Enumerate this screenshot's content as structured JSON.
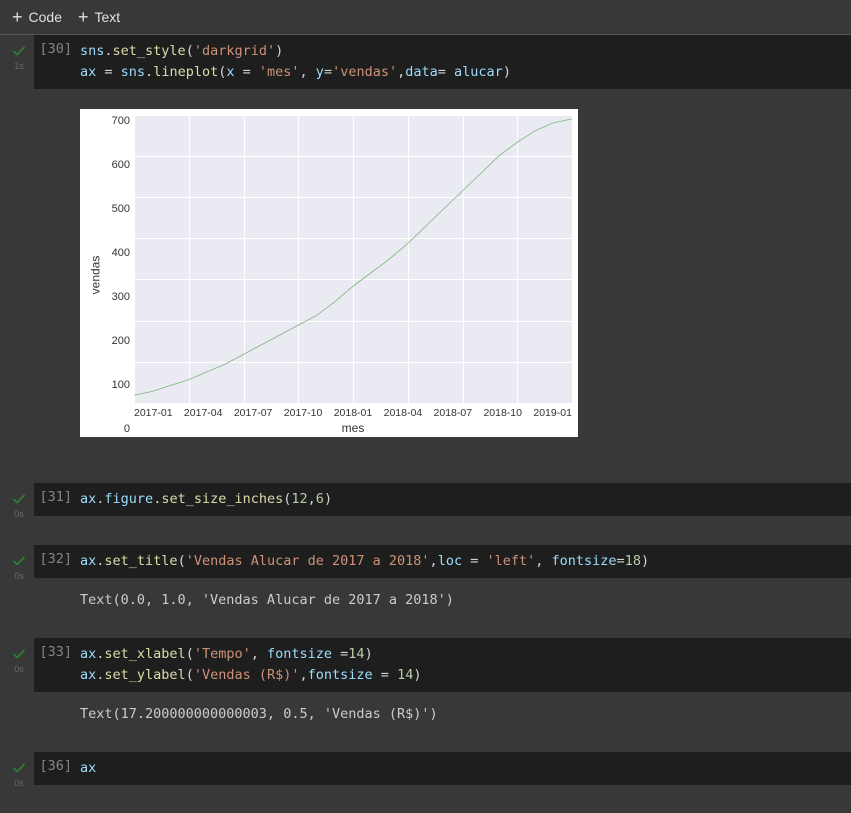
{
  "toolbar": {
    "code": "Code",
    "text": "Text"
  },
  "cells": [
    {
      "exec_count": "[30]",
      "exec_time": "1s",
      "code_tokens": [
        [
          "var",
          "sns"
        ],
        [
          "plain",
          "."
        ],
        [
          "fn",
          "set_style"
        ],
        [
          "plain",
          "("
        ],
        [
          "str",
          "'darkgrid'"
        ],
        [
          "plain",
          ")\n"
        ],
        [
          "var",
          "ax"
        ],
        [
          "plain",
          " = "
        ],
        [
          "var",
          "sns"
        ],
        [
          "plain",
          "."
        ],
        [
          "fn",
          "lineplot"
        ],
        [
          "plain",
          "("
        ],
        [
          "var",
          "x"
        ],
        [
          "plain",
          " = "
        ],
        [
          "str",
          "'mes'"
        ],
        [
          "plain",
          ", "
        ],
        [
          "var",
          "y"
        ],
        [
          "plain",
          "="
        ],
        [
          "str",
          "'vendas'"
        ],
        [
          "plain",
          ","
        ],
        [
          "var",
          "data"
        ],
        [
          "plain",
          "= "
        ],
        [
          "var",
          "alucar"
        ],
        [
          "plain",
          ")"
        ]
      ]
    },
    {
      "exec_count": "[31]",
      "exec_time": "0s",
      "code_tokens": [
        [
          "var",
          "ax"
        ],
        [
          "plain",
          "."
        ],
        [
          "var",
          "figure"
        ],
        [
          "plain",
          "."
        ],
        [
          "fn",
          "set_size_inches"
        ],
        [
          "plain",
          "("
        ],
        [
          "num",
          "12"
        ],
        [
          "plain",
          ","
        ],
        [
          "num",
          "6"
        ],
        [
          "plain",
          ")"
        ]
      ]
    },
    {
      "exec_count": "[32]",
      "exec_time": "0s",
      "code_tokens": [
        [
          "var",
          "ax"
        ],
        [
          "plain",
          "."
        ],
        [
          "fn",
          "set_title"
        ],
        [
          "plain",
          "("
        ],
        [
          "str",
          "'Vendas Alucar de 2017 a 2018'"
        ],
        [
          "plain",
          ","
        ],
        [
          "var",
          "loc"
        ],
        [
          "plain",
          " = "
        ],
        [
          "str",
          "'left'"
        ],
        [
          "plain",
          ", "
        ],
        [
          "var",
          "fontsize"
        ],
        [
          "plain",
          "="
        ],
        [
          "num",
          "18"
        ],
        [
          "plain",
          ")"
        ]
      ],
      "output": "Text(0.0, 1.0, 'Vendas Alucar de 2017 a 2018')"
    },
    {
      "exec_count": "[33]",
      "exec_time": "0s",
      "code_tokens": [
        [
          "var",
          "ax"
        ],
        [
          "plain",
          "."
        ],
        [
          "fn",
          "set_xlabel"
        ],
        [
          "plain",
          "("
        ],
        [
          "str",
          "'Tempo'"
        ],
        [
          "plain",
          ", "
        ],
        [
          "var",
          "fontsize"
        ],
        [
          "plain",
          " ="
        ],
        [
          "num",
          "14"
        ],
        [
          "plain",
          ")\n"
        ],
        [
          "var",
          "ax"
        ],
        [
          "plain",
          "."
        ],
        [
          "fn",
          "set_ylabel"
        ],
        [
          "plain",
          "("
        ],
        [
          "str",
          "'Vendas (R$)'"
        ],
        [
          "plain",
          ","
        ],
        [
          "var",
          "fontsize"
        ],
        [
          "plain",
          " = "
        ],
        [
          "num",
          "14"
        ],
        [
          "plain",
          ")"
        ]
      ],
      "output": "Text(17.200000000000003, 0.5, 'Vendas (R$)')"
    },
    {
      "exec_count": "[36]",
      "exec_time": "0s",
      "code_tokens": [
        [
          "var",
          "ax"
        ]
      ]
    }
  ],
  "chart_data": {
    "type": "line",
    "xlabel": "mes",
    "ylabel": "vendas",
    "x_ticks": [
      "2017-01",
      "2017-04",
      "2017-07",
      "2017-10",
      "2018-01",
      "2018-04",
      "2018-07",
      "2018-10",
      "2019-01"
    ],
    "y_ticks": [
      "0",
      "100",
      "200",
      "300",
      "400",
      "500",
      "600",
      "700"
    ],
    "ylim": [
      0,
      740
    ],
    "x": [
      "2017-01",
      "2017-02",
      "2017-03",
      "2017-04",
      "2017-05",
      "2017-06",
      "2017-07",
      "2017-08",
      "2017-09",
      "2017-10",
      "2017-11",
      "2017-12",
      "2018-01",
      "2018-02",
      "2018-03",
      "2018-04",
      "2018-05",
      "2018-06",
      "2018-07",
      "2018-08",
      "2018-09",
      "2018-10",
      "2018-11",
      "2018-12",
      "2019-01"
    ],
    "values": [
      20,
      30,
      45,
      60,
      80,
      100,
      125,
      150,
      175,
      200,
      225,
      260,
      300,
      335,
      370,
      410,
      455,
      500,
      545,
      590,
      635,
      670,
      700,
      720,
      730
    ],
    "line_color": "#7eb77e"
  }
}
